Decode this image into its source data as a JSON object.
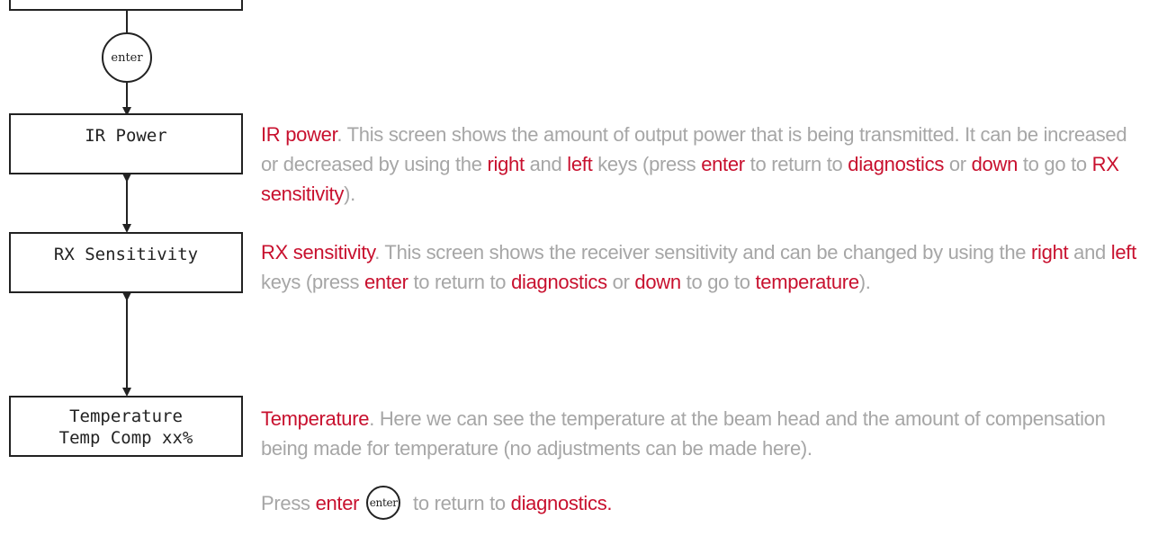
{
  "flow": {
    "enter_label": "enter",
    "ir_box": "IR Power",
    "rx_box": "RX Sensitivity",
    "temp_box_line1": "Temperature",
    "temp_box_line2": "Temp Comp xx%"
  },
  "ir_desc": {
    "title": "IR power",
    "t1": ". This screen shows the amount of output power that is being transmitted. It can be increased or decreased by using the ",
    "right": "right",
    "t2": " and ",
    "left": "left",
    "t3": " keys (press ",
    "enter": "enter",
    "t4": " to return to ",
    "diagnostics": "diagnostics",
    "t5": " or ",
    "down": "down",
    "t6": " to go to ",
    "next": "RX sensitivity",
    "t7": ")."
  },
  "rx_desc": {
    "title": "RX sensitivity",
    "t1": ". This screen shows the receiver sensitivity and can be changed by using the ",
    "right": "right",
    "t2": " and ",
    "left": "left",
    "t3": " keys (press ",
    "enter": "enter",
    "t4": " to return to ",
    "diagnostics": "diagnostics",
    "t5": " or ",
    "down": "down",
    "t6": " to go to ",
    "next": "temperature",
    "t7": ")."
  },
  "temp_desc": {
    "title": "Temperature",
    "t1": ". Here we can see the temperature at the beam head and the amount of compensation being made for temperature (no adjustments can be made here)."
  },
  "press": {
    "t1": "Press ",
    "enter": "enter",
    "circle_label": "enter",
    "t2": " to return to ",
    "diagnostics": "diagnostics."
  },
  "colors": {
    "highlight": "#c8102e",
    "body_text": "#a6a6a6",
    "line": "#222222"
  }
}
